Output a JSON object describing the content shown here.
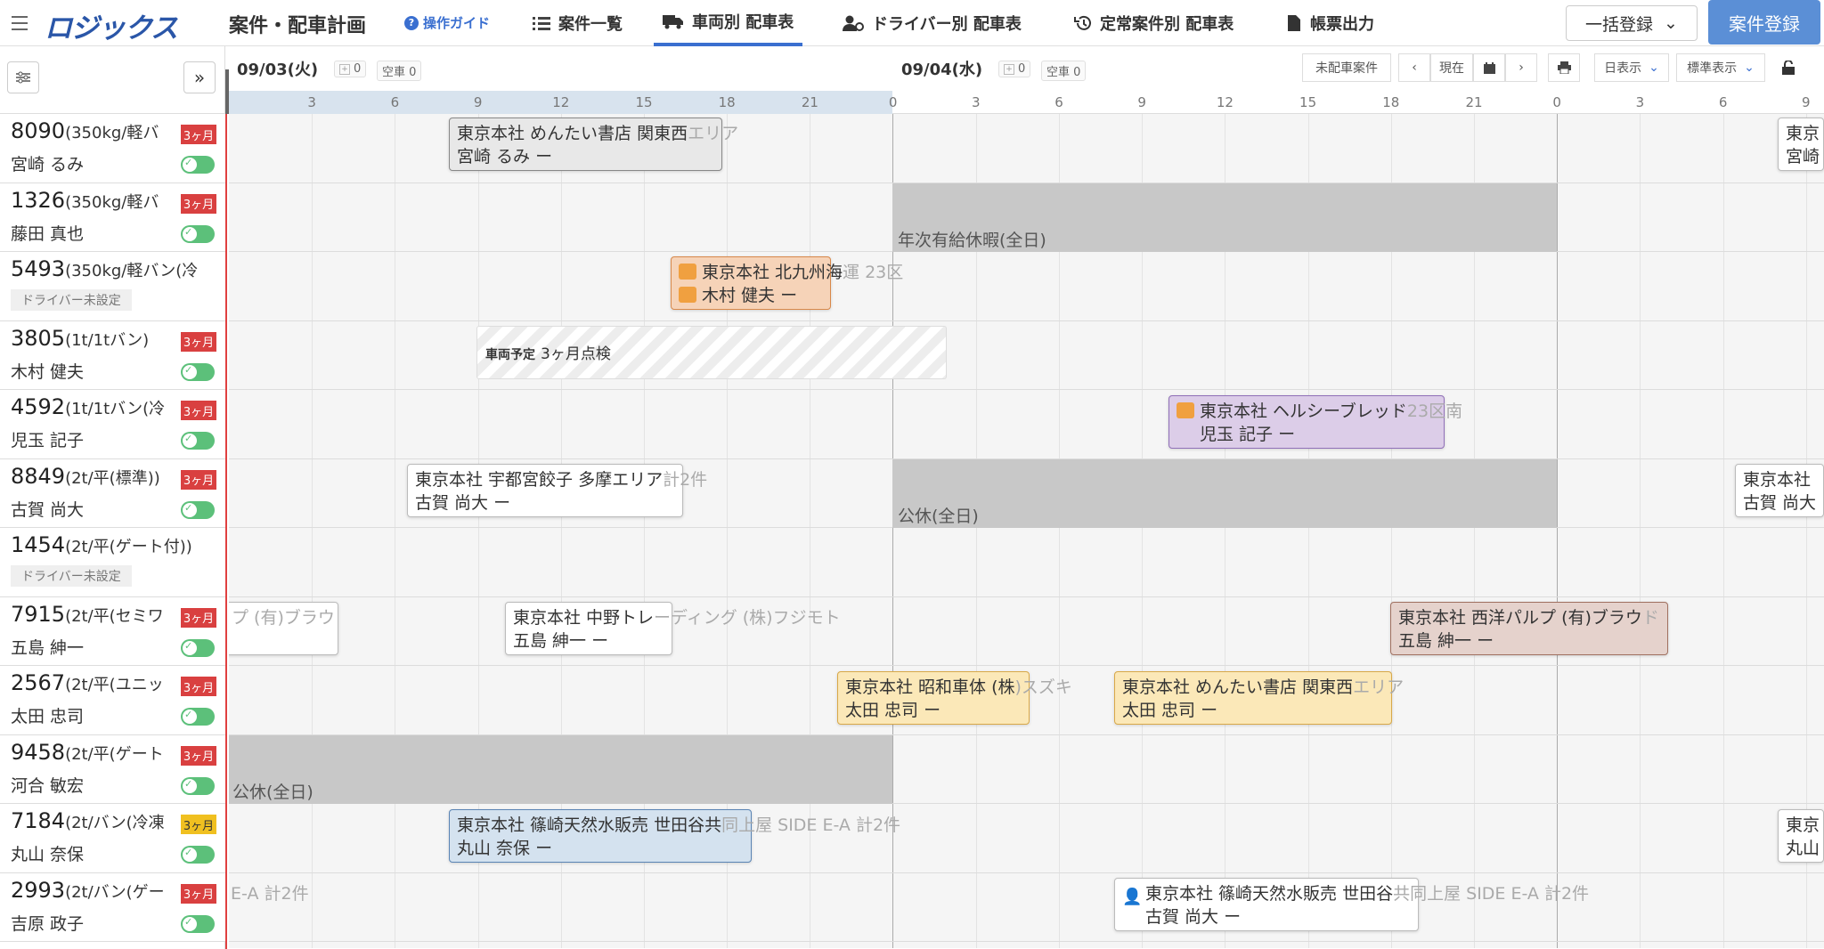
{
  "header": {
    "logo": "ロジックス",
    "title": "案件・配車計画",
    "guide": "操作ガイド",
    "nav": [
      {
        "label": "案件一覧"
      },
      {
        "label": "車両別 配車表"
      },
      {
        "label": "ドライバー別 配車表"
      },
      {
        "label": "定常案件別 配車表"
      },
      {
        "label": "帳票出力"
      }
    ],
    "bulk_label": "一括登録",
    "register_label": "案件登録"
  },
  "toolbar": {
    "collapse": "»",
    "unassigned": "未配車案件",
    "now": "現在",
    "day_view": "日表示",
    "std_view": "標準表示"
  },
  "timeline": {
    "days": [
      {
        "label": "09/03(火)",
        "count": "0",
        "empty": "空車 0"
      },
      {
        "label": "09/04(水)",
        "count": "0",
        "empty": "空車 0"
      }
    ],
    "ticks": [
      "3",
      "6",
      "9",
      "12",
      "15",
      "18",
      "21",
      "0",
      "3",
      "6",
      "9",
      "12",
      "15",
      "18",
      "21",
      "0",
      "3",
      "6",
      "9"
    ]
  },
  "rows": [
    {
      "id": "8090",
      "spec": "(350kg/軽バ",
      "badge": "3ヶ月",
      "driver": "宮崎 るみ"
    },
    {
      "id": "1326",
      "spec": "(350kg/軽バ",
      "badge": "3ヶ月",
      "driver": "藤田 真也"
    },
    {
      "id": "5493",
      "spec": "(350kg/軽バン(冷",
      "badge": "",
      "driver": "",
      "nodriver": "ドライバー未設定"
    },
    {
      "id": "3805",
      "spec": "(1t/1tバン)",
      "badge": "3ヶ月",
      "driver": "木村 健夫"
    },
    {
      "id": "4592",
      "spec": "(1t/1tバン(冷",
      "badge": "3ヶ月",
      "driver": "児玉 記子"
    },
    {
      "id": "8849",
      "spec": "(2t/平(標準))",
      "badge": "3ヶ月",
      "driver": "古賀 尚大"
    },
    {
      "id": "1454",
      "spec": "(2t/平(ゲート付))",
      "badge": "",
      "driver": "",
      "nodriver": "ドライバー未設定"
    },
    {
      "id": "7915",
      "spec": "(2t/平(セミワ",
      "badge": "3ヶ月",
      "driver": "五島 紳一"
    },
    {
      "id": "2567",
      "spec": "(2t/平(ユニッ",
      "badge": "3ヶ月",
      "driver": "太田 忠司"
    },
    {
      "id": "9458",
      "spec": "(2t/平(ゲート",
      "badge": "3ヶ月",
      "driver": "河合 敏宏"
    },
    {
      "id": "7184",
      "spec": "(2t/バン(冷凍",
      "badge": "3ヶ月",
      "badge_color": "yellow",
      "driver": "丸山 奈保"
    },
    {
      "id": "2993",
      "spec": "(2t/バン(ゲー",
      "badge": "3ヶ月",
      "driver": "吉原 政子"
    }
  ],
  "cards": {
    "c1": {
      "l1": "東京本社  めんたい書店  関東西",
      "ov": "エリア",
      "l2": "宮崎 るみ  ー"
    },
    "c2": {
      "l1": "東京本社  北九州海",
      "ov": "運  23区",
      "l2": "木村 健夫  ー"
    },
    "c3": {
      "l1": "東京本社  ヘルシーブレッド",
      "ov": "23区南",
      "l2": "児玉 記子  ー"
    },
    "c4": {
      "l1": "東京本社  宇都宮餃子  多摩エリア",
      "ov": "計2件",
      "l2": "古賀 尚大  ー"
    },
    "c5": {
      "l1": "東京本社  中野トレ",
      "ov": "ーディング (株)フジモト",
      "l2": "五島 紳一  ー"
    },
    "c6": {
      "l1": "東京本社  西洋パルプ (有)ブラウ",
      "ov": "ド",
      "l2": "五島 紳一  ー"
    },
    "c7": {
      "l1": "東京本社  昭和車体 (株",
      "ov": ")スズキ",
      "l2": "太田 忠司  ー"
    },
    "c8": {
      "l1": "東京本社  めんたい書店  関東西",
      "ov": "エリア",
      "l2": "太田 忠司  ー"
    },
    "c9": {
      "l1": "東京本社  篠崎天然水販売  世田谷共",
      "ov": "同上屋    SIDE E-A  計2件",
      "l2": "丸山 奈保  ー"
    },
    "c10": {
      "l1": "東京本社  篠崎天然水販売  世田谷",
      "ov": "共同上屋    SIDE E-A  計2件",
      "l2": "古賀 尚大  ー"
    },
    "c11": {
      "l1": "東京",
      "l2": "宮崎"
    },
    "c12": {
      "l1": "東京本社",
      "l2": "古賀 尚大"
    },
    "c13": {
      "l1": "東京",
      "l2": "丸山"
    },
    "c14": {
      "l1": "プ (有)ブラウド",
      "l2": ""
    }
  },
  "ghosts": {
    "g1": "E-A  計2件"
  },
  "blocks": {
    "b1": "年次有給休暇(全日)",
    "b2": "公休(全日)",
    "b3": "公休(全日)"
  },
  "hatch": {
    "tag": "車両予定",
    "label": "3ヶ月点検"
  }
}
